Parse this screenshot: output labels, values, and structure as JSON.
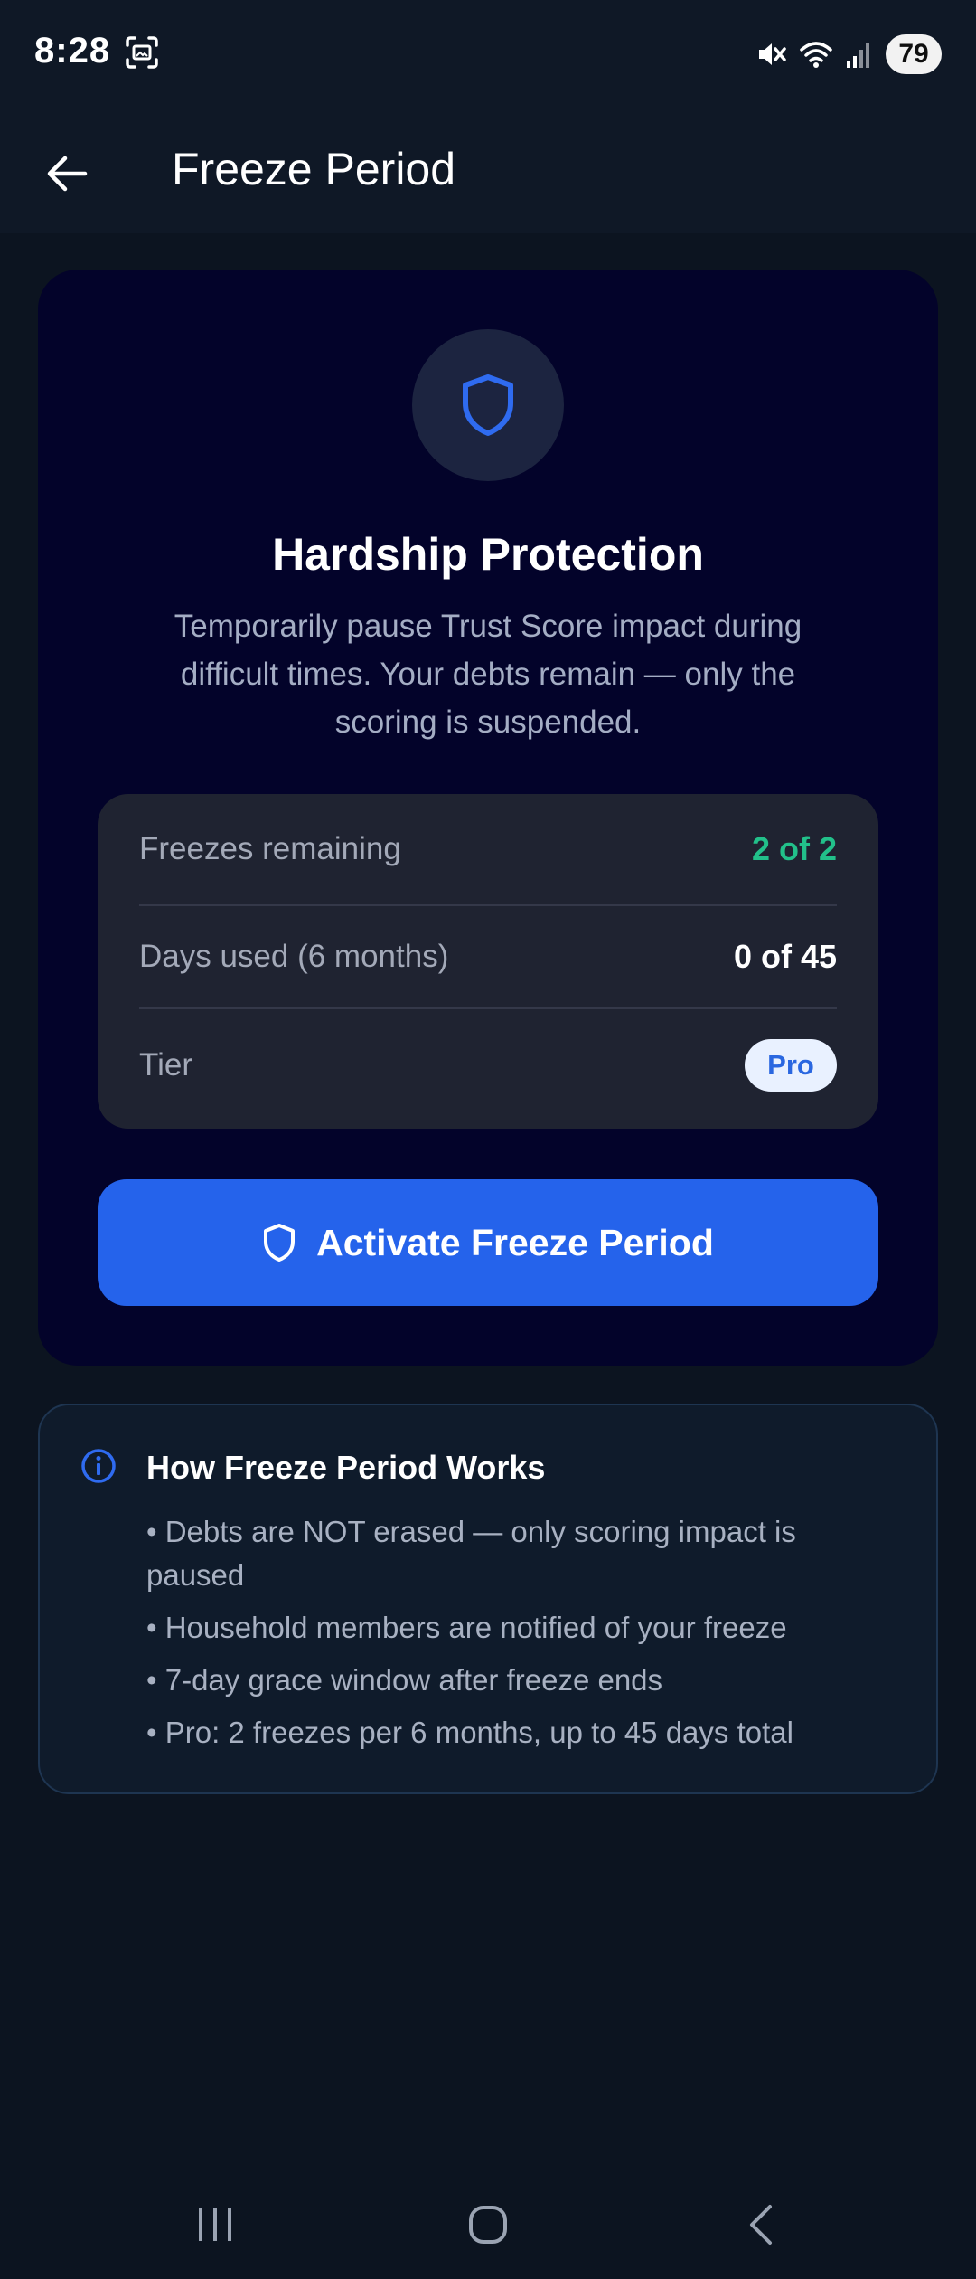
{
  "status_bar": {
    "time": "8:28",
    "battery": "79",
    "icons": [
      "screenshot-icon",
      "mute-icon",
      "wifi-icon",
      "signal-icon",
      "battery-icon"
    ]
  },
  "app_bar": {
    "title": "Freeze Period",
    "back_icon": "arrow-left-icon"
  },
  "protection_card": {
    "icon": "shield-icon",
    "title": "Hardship Protection",
    "description": "Temporarily pause Trust Score impact during difficult times. Your debts remain — only the scoring is suspended.",
    "stats": {
      "freezes_label": "Freezes remaining",
      "freezes_value": "2 of 2",
      "days_label": "Days used (6 months)",
      "days_value": "0 of 45",
      "tier_label": "Tier",
      "tier_value": "Pro"
    },
    "activate_button": "Activate Freeze Period"
  },
  "info_card": {
    "icon": "info-icon",
    "title": "How Freeze Period Works",
    "items": [
      "• Debts are NOT erased — only scoring impact is paused",
      "• Household members are notified of your freeze",
      "• 7-day grace window after freeze ends",
      "• Pro: 2 freezes per 6 months, up to 45 days total"
    ]
  },
  "colors": {
    "background": "#0c1420",
    "card": "#03032a",
    "accent": "#2563eb",
    "success": "#22c08a"
  }
}
